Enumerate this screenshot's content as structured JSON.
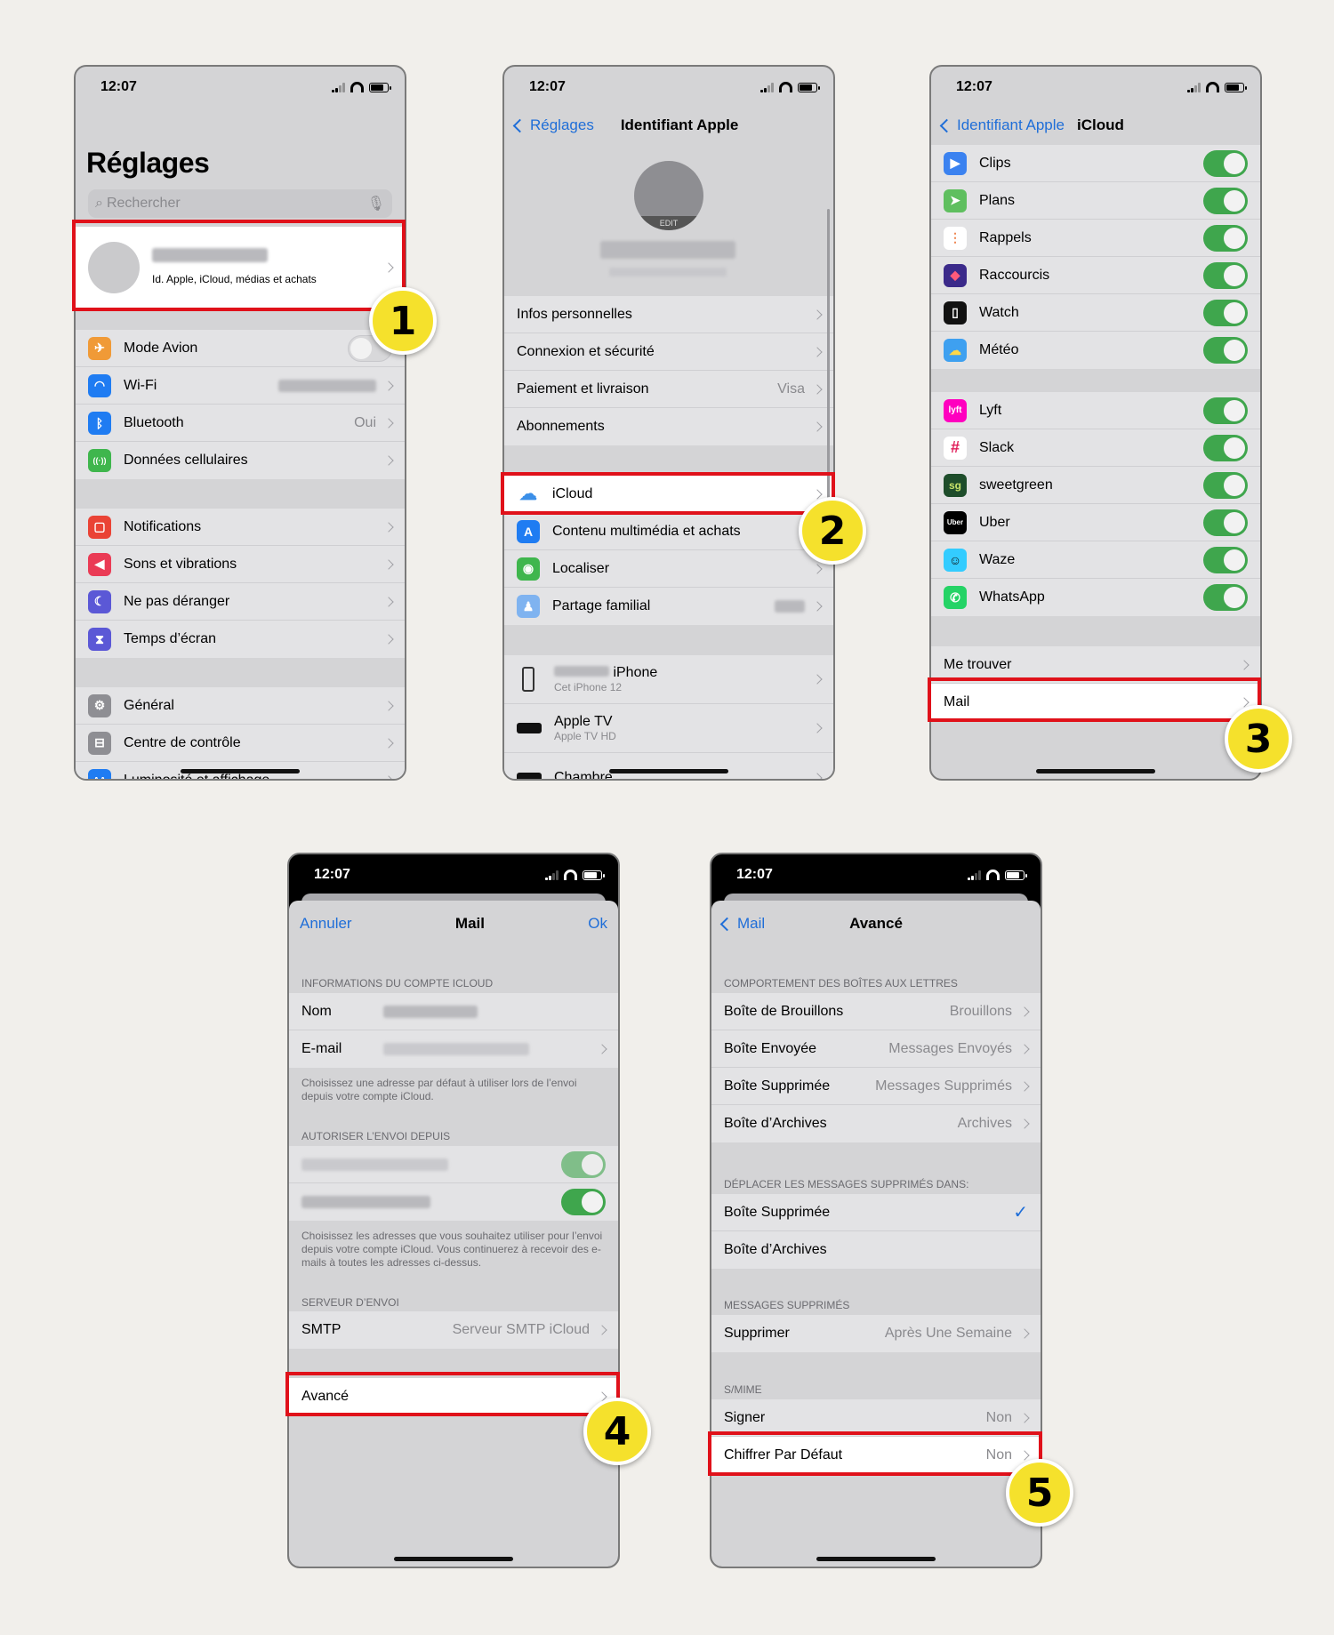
{
  "time": "12:07",
  "p1": {
    "title": "Réglages",
    "search_placeholder": "Rechercher",
    "account_sub": "Id. Apple, iCloud, médias et achats",
    "g1": [
      {
        "label": "Mode Avion",
        "color": "#f09a37",
        "icon": "✈"
      },
      {
        "label": "Wi-Fi",
        "color": "#1f7cf2",
        "icon": "◠"
      },
      {
        "label": "Bluetooth",
        "value": "Oui",
        "color": "#1f7cf2",
        "icon": "ᛒ"
      },
      {
        "label": "Données cellulaires",
        "color": "#3fb64d",
        "icon": "((·))"
      }
    ],
    "g2": [
      {
        "label": "Notifications",
        "color": "#ea4335",
        "icon": "▢"
      },
      {
        "label": "Sons et vibrations",
        "color": "#ea3b55",
        "icon": "◀"
      },
      {
        "label": "Ne pas déranger",
        "color": "#5b58d6",
        "icon": "☾"
      },
      {
        "label": "Temps d’écran",
        "color": "#5b58d6",
        "icon": "⧗"
      }
    ],
    "g3": [
      {
        "label": "Général",
        "color": "#8e8e93",
        "icon": "⚙"
      },
      {
        "label": "Centre de contrôle",
        "color": "#8e8e93",
        "icon": "⊟"
      },
      {
        "label": "Luminosité et affichage",
        "color": "#1f7cf2",
        "icon": "AA"
      }
    ]
  },
  "p2": {
    "back": "Réglages",
    "title": "Identifiant Apple",
    "edit": "EDIT",
    "g1": [
      {
        "label": "Infos personnelles"
      },
      {
        "label": "Connexion et sécurité"
      },
      {
        "label": "Paiement et livraison",
        "value": "Visa"
      },
      {
        "label": "Abonnements"
      }
    ],
    "g2": [
      {
        "label": "iCloud",
        "color": "#ffffff",
        "icon": "☁"
      },
      {
        "label": "Contenu multimédia et achats",
        "color": "#1f7cf2",
        "icon": "A"
      },
      {
        "label": "Localiser",
        "color": "#3fb64d",
        "icon": "◉"
      },
      {
        "label": "Partage familial",
        "color": "#7fb3f0",
        "icon": "♟"
      }
    ],
    "devices": [
      {
        "name": "iPhone",
        "sub": "Cet iPhone 12"
      },
      {
        "name": "Apple TV",
        "sub": "Apple TV HD"
      },
      {
        "name": "Chambre",
        "sub": ""
      }
    ]
  },
  "p3": {
    "back": "Identifiant Apple",
    "title": "iCloud",
    "g1": [
      {
        "label": "Clips",
        "color": "#3b82f0",
        "icon": "▶"
      },
      {
        "label": "Plans",
        "color": "#5fbf5f",
        "icon": "➤"
      },
      {
        "label": "Rappels",
        "color": "#ffffff",
        "icon": "⋮"
      },
      {
        "label": "Raccourcis",
        "color": "#3b2a8a",
        "icon": "◆"
      },
      {
        "label": "Watch",
        "color": "#111111",
        "icon": "▯"
      },
      {
        "label": "Météo",
        "color": "#3ea0f0",
        "icon": "☁"
      }
    ],
    "g2": [
      {
        "label": "Lyft",
        "color": "#ff00bf",
        "icon": "lyft"
      },
      {
        "label": "Slack",
        "color": "#ffffff",
        "icon": "#"
      },
      {
        "label": "sweetgreen",
        "color": "#1e4d2b",
        "icon": "sg"
      },
      {
        "label": "Uber",
        "color": "#000000",
        "icon": "Uber"
      },
      {
        "label": "Waze",
        "color": "#33ccff",
        "icon": "☺"
      },
      {
        "label": "WhatsApp",
        "color": "#25d366",
        "icon": "✆"
      }
    ],
    "find": "Me trouver",
    "mail": "Mail"
  },
  "p4": {
    "cancel": "Annuler",
    "title": "Mail",
    "ok": "Ok",
    "h1": "INFORMATIONS DU COMPTE ICLOUD",
    "name_label": "Nom",
    "email_label": "E-mail",
    "note1": "Choisissez une adresse par défaut à utiliser lors de l’envoi depuis votre compte iCloud.",
    "h2": "AUTORISER L’ENVOI DEPUIS",
    "note2": "Choisissez les adresses que vous souhaitez utiliser pour l’envoi depuis votre compte iCloud. Vous continuerez à recevoir des e-mails à toutes les adresses ci-dessus.",
    "h3": "SERVEUR D’ENVOI",
    "smtp_label": "SMTP",
    "smtp_value": "Serveur SMTP iCloud",
    "advanced": "Avancé"
  },
  "p5": {
    "back": "Mail",
    "title": "Avancé",
    "h1": "COMPORTEMENT DES BOÎTES AUX LETTRES",
    "g1": [
      {
        "label": "Boîte de Brouillons",
        "value": "Brouillons"
      },
      {
        "label": "Boîte Envoyée",
        "value": "Messages Envoyés"
      },
      {
        "label": "Boîte Supprimée",
        "value": "Messages Supprimés"
      },
      {
        "label": "Boîte d’Archives",
        "value": "Archives"
      }
    ],
    "h2": "DÉPLACER LES MESSAGES SUPPRIMÉS DANS:",
    "g2": [
      {
        "label": "Boîte Supprimée"
      },
      {
        "label": "Boîte d’Archives"
      }
    ],
    "h3": "MESSAGES SUPPRIMÉS",
    "delete_label": "Supprimer",
    "delete_value": "Après Une Semaine",
    "h4": "S/MIME",
    "sign_label": "Signer",
    "sign_value": "Non",
    "encrypt_label": "Chiffrer Par Défaut",
    "encrypt_value": "Non"
  },
  "badges": [
    "1",
    "2",
    "3",
    "4",
    "5"
  ]
}
